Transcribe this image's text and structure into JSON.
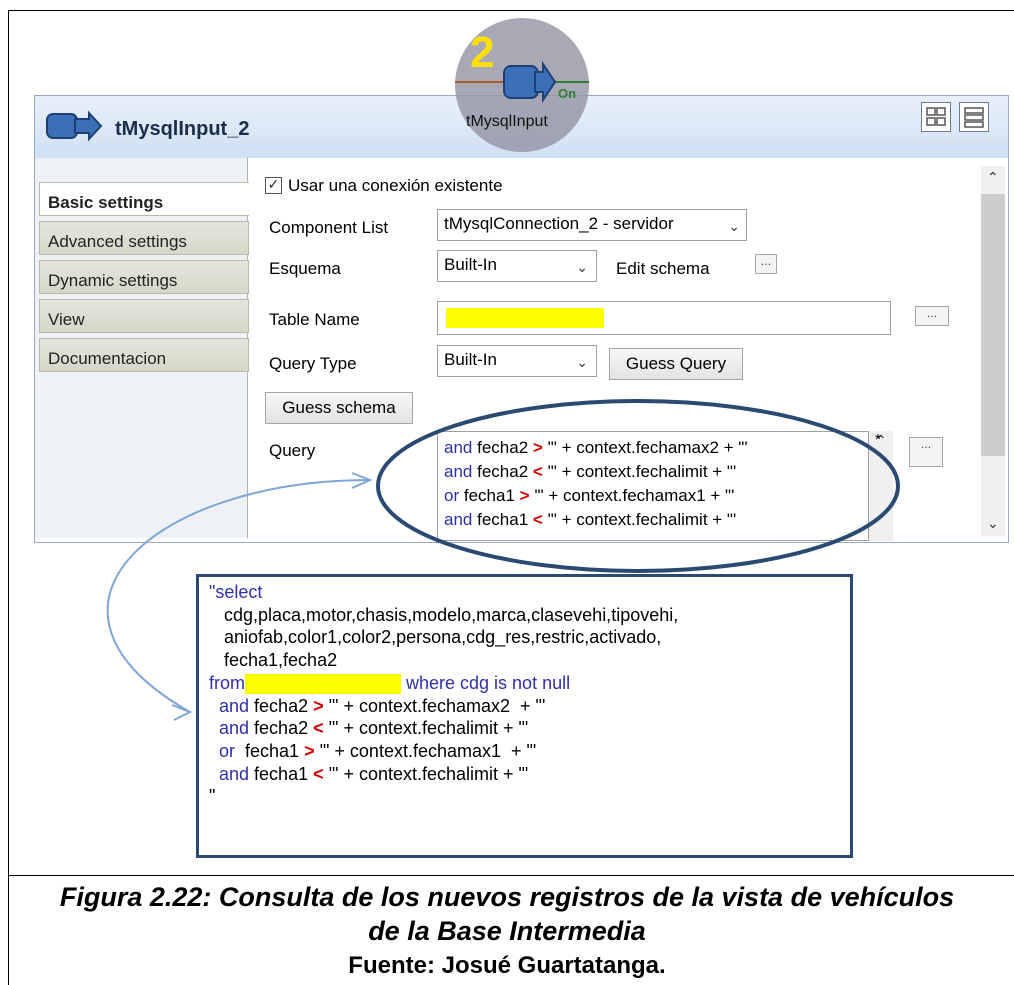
{
  "panel": {
    "title": "tMysqlInput_2",
    "tabs": [
      "Basic settings",
      "Advanced settings",
      "Dynamic settings",
      "View",
      "Documentacion"
    ],
    "use_existing_connection_label": "Usar una conexión existente",
    "use_existing_connection_checked": true,
    "component_list_label": "Component List",
    "component_list_value": "tMysqlConnection_2 - servidor",
    "schema_label": "Esquema",
    "schema_value": "Built-In",
    "edit_schema_label": "Edit schema",
    "table_name_label": "Table Name",
    "query_type_label": "Query Type",
    "query_type_value": "Built-In",
    "guess_query_label": "Guess Query",
    "guess_schema_label": "Guess schema",
    "query_label": "Query",
    "ellipsis": "...",
    "asterisk": "*"
  },
  "badge": {
    "number": "2",
    "label": "tMysqlInput",
    "on_label": "On"
  },
  "query_preview": [
    {
      "kw": "and",
      "field": "fecha2",
      "op": ">",
      "rest": "'\" + context.fechamax2  + \"'"
    },
    {
      "kw": "and",
      "field": "fecha2",
      "op": "<",
      "rest": "'\" + context.fechalimit + \"'"
    },
    {
      "kw": "or",
      "field": "fecha1",
      "op": ">",
      "rest": "'\" + context.fechamax1  + \"'"
    },
    {
      "kw": "and",
      "field": "fecha1",
      "op": "<",
      "rest": "'\" + context.fechalimit + \"'"
    }
  ],
  "code": {
    "line1": "\"select",
    "line2": "   cdg,placa,motor,chasis,modelo,marca,clasevehi,tipovehi,",
    "line3": "   aniofab,color1,color2,persona,cdg_res,restric,activado,",
    "line4": "   fecha1,fecha2",
    "from_kw": "from",
    "where_text": " where cdg is not null",
    "conditions": [
      {
        "kw": "  and",
        "field": " fecha2 ",
        "op": ">",
        "rest": " '\" + context.fechamax2  + \"'"
      },
      {
        "kw": "  and",
        "field": " fecha2 ",
        "op": "<",
        "rest": " '\" + context.fechalimit + \"'"
      },
      {
        "kw": "  or",
        "field": "  fecha1 ",
        "op": ">",
        "rest": " '\" + context.fechamax1  + \"'"
      },
      {
        "kw": "  and",
        "field": " fecha1 ",
        "op": "<",
        "rest": " '\" + context.fechalimit + \"'"
      }
    ],
    "last_line": "\""
  },
  "caption": {
    "line1": "Figura 2.22: Consulta de los nuevos registros de la vista de vehículos",
    "line2": "de la Base Intermedia",
    "line3": "Fuente: Josué Guartatanga."
  },
  "colors": {
    "keyword": "#2f2fa8",
    "operator": "#d50000",
    "highlight": "#ffff00",
    "annotation": "#2b4a72"
  }
}
